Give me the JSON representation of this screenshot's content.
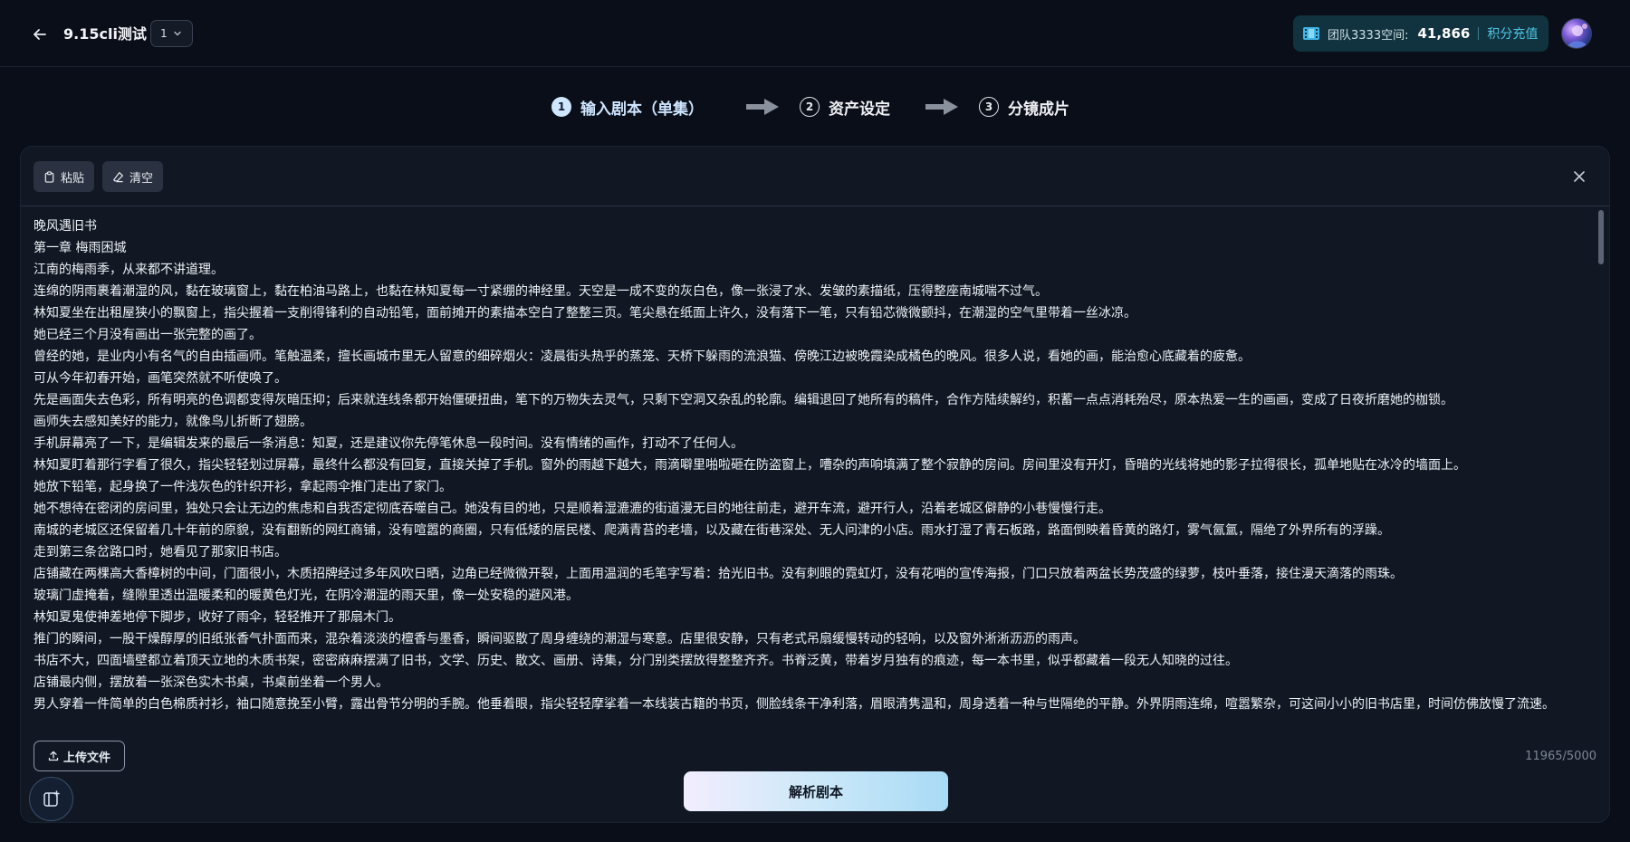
{
  "header": {
    "project_title": "9.15cli测试",
    "version": "1",
    "team_label": "团队3333空间:",
    "credits": "41,866",
    "recharge_label": "积分充值"
  },
  "stepper": {
    "steps": [
      {
        "number": "1",
        "label": "输入剧本（单集）",
        "active": true
      },
      {
        "number": "2",
        "label": "资产设定",
        "active": false
      },
      {
        "number": "3",
        "label": "分镜成片",
        "active": false
      }
    ]
  },
  "editor": {
    "paste_label": "粘贴",
    "clear_label": "清空",
    "upload_label": "上传文件",
    "char_count": "11965/5000",
    "parse_label": "解析剧本",
    "lines": [
      "晚风遇旧书",
      "第一章 梅雨困城",
      "江南的梅雨季，从来都不讲道理。",
      "连绵的阴雨裹着潮湿的风，黏在玻璃窗上，黏在柏油马路上，也黏在林知夏每一寸紧绷的神经里。天空是一成不变的灰白色，像一张浸了水、发皱的素描纸，压得整座南城喘不过气。",
      "林知夏坐在出租屋狭小的飘窗上，指尖握着一支削得锋利的自动铅笔，面前摊开的素描本空白了整整三页。笔尖悬在纸面上许久，没有落下一笔，只有铅芯微微颤抖，在潮湿的空气里带着一丝冰凉。",
      "她已经三个月没有画出一张完整的画了。",
      "曾经的她，是业内小有名气的自由插画师。笔触温柔，擅长画城市里无人留意的细碎烟火：凌晨街头热乎的蒸笼、天桥下躲雨的流浪猫、傍晚江边被晚霞染成橘色的晚风。很多人说，看她的画，能治愈心底藏着的疲惫。",
      "可从今年初春开始，画笔突然就不听使唤了。",
      "先是画面失去色彩，所有明亮的色调都变得灰暗压抑；后来就连线条都开始僵硬扭曲，笔下的万物失去灵气，只剩下空洞又杂乱的轮廓。编辑退回了她所有的稿件，合作方陆续解约，积蓄一点点消耗殆尽，原本热爱一生的画画，变成了日夜折磨她的枷锁。",
      "画师失去感知美好的能力，就像鸟儿折断了翅膀。",
      "手机屏幕亮了一下，是编辑发来的最后一条消息：知夏，还是建议你先停笔休息一段时间。没有情绪的画作，打动不了任何人。",
      "林知夏盯着那行字看了很久，指尖轻轻划过屏幕，最终什么都没有回复，直接关掉了手机。窗外的雨越下越大，雨滴噼里啪啦砸在防盗窗上，嘈杂的声响填满了整个寂静的房间。房间里没有开灯，昏暗的光线将她的影子拉得很长，孤单地贴在冰冷的墙面上。",
      "她放下铅笔，起身换了一件浅灰色的针织开衫，拿起雨伞推门走出了家门。",
      "她不想待在密闭的房间里，独处只会让无边的焦虑和自我否定彻底吞噬自己。她没有目的地，只是顺着湿漉漉的街道漫无目的地往前走，避开车流，避开行人，沿着老城区僻静的小巷慢慢行走。",
      "南城的老城区还保留着几十年前的原貌，没有翻新的网红商铺，没有喧嚣的商圈，只有低矮的居民楼、爬满青苔的老墙，以及藏在街巷深处、无人问津的小店。雨水打湿了青石板路，路面倒映着昏黄的路灯，雾气氤氲，隔绝了外界所有的浮躁。",
      "走到第三条岔路口时，她看见了那家旧书店。",
      "店铺藏在两棵高大香樟树的中间，门面很小，木质招牌经过多年风吹日晒，边角已经微微开裂，上面用温润的毛笔字写着：拾光旧书。没有刺眼的霓虹灯，没有花哨的宣传海报，门口只放着两盆长势茂盛的绿萝，枝叶垂落，接住漫天滴落的雨珠。",
      "玻璃门虚掩着，缝隙里透出温暖柔和的暖黄色灯光，在阴冷潮湿的雨天里，像一处安稳的避风港。",
      "林知夏鬼使神差地停下脚步，收好了雨伞，轻轻推开了那扇木门。",
      "推门的瞬间，一股干燥醇厚的旧纸张香气扑面而来，混杂着淡淡的檀香与墨香，瞬间驱散了周身缠绕的潮湿与寒意。店里很安静，只有老式吊扇缓慢转动的轻响，以及窗外淅淅沥沥的雨声。",
      "书店不大，四面墙壁都立着顶天立地的木质书架，密密麻麻摆满了旧书，文学、历史、散文、画册、诗集，分门别类摆放得整整齐齐。书脊泛黄，带着岁月独有的痕迹，每一本书里，似乎都藏着一段无人知晓的过往。",
      "店铺最内侧，摆放着一张深色实木书桌，书桌前坐着一个男人。",
      "男人穿着一件简单的白色棉质衬衫，袖口随意挽至小臂，露出骨节分明的手腕。他垂着眼，指尖轻轻摩挲着一本线装古籍的书页，侧脸线条干净利落，眉眼清隽温和，周身透着一种与世隔绝的平静。外界阴雨连绵，喧嚣繁杂，可这间小小的旧书店里，时间仿佛放慢了流速。"
    ]
  },
  "colors": {
    "background": "#0a0e18",
    "card": "#111824",
    "accent": "#4fc6e6",
    "step_active": "#cfe6ff"
  },
  "icons": {
    "back": "arrow-left-icon",
    "version": "chevron-down-icon",
    "credits": "film-icon",
    "paste": "clipboard-icon",
    "clear": "eraser-icon",
    "close": "close-icon",
    "upload": "upload-icon",
    "float": "sidebar-add-icon"
  }
}
